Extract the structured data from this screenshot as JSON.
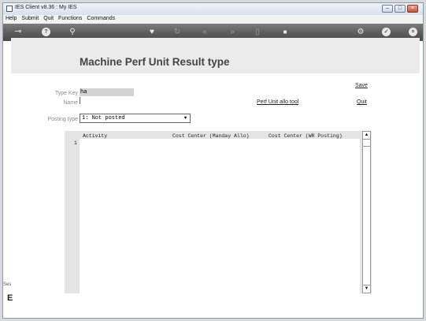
{
  "window": {
    "title": "IES Client v8.36 : My IES"
  },
  "menu": [
    "Help",
    "Submit",
    "Quit",
    "Functions",
    "Commands"
  ],
  "toolbar": {
    "icons": [
      "key-icon",
      "help-icon",
      "search-icon",
      "heart-icon",
      "refresh-icon",
      "rewind-icon",
      "forward-icon",
      "document-icon",
      "stop-icon",
      "settings-icon",
      "check-icon",
      "close-icon"
    ]
  },
  "page": {
    "title": "Machine Perf Unit Result type"
  },
  "form": {
    "type_key_label": "Type Key",
    "type_key_value": "ha",
    "name_label": "Name",
    "posting_type_label": "Posting type",
    "posting_type_value": "1: Not posted"
  },
  "links": {
    "save": "Save",
    "perf_unit_tool": "Perf Unit allo tool",
    "quit": "Quit"
  },
  "grid": {
    "columns": [
      "Activity",
      "Cost Center (Manday Allo)",
      "Cost Center (WR Posting)"
    ],
    "rows": [
      {
        "num": "1",
        "cells": [
          "",
          "",
          ""
        ]
      }
    ]
  },
  "status": {
    "left_label": "Ses",
    "left_glyph": "E"
  }
}
